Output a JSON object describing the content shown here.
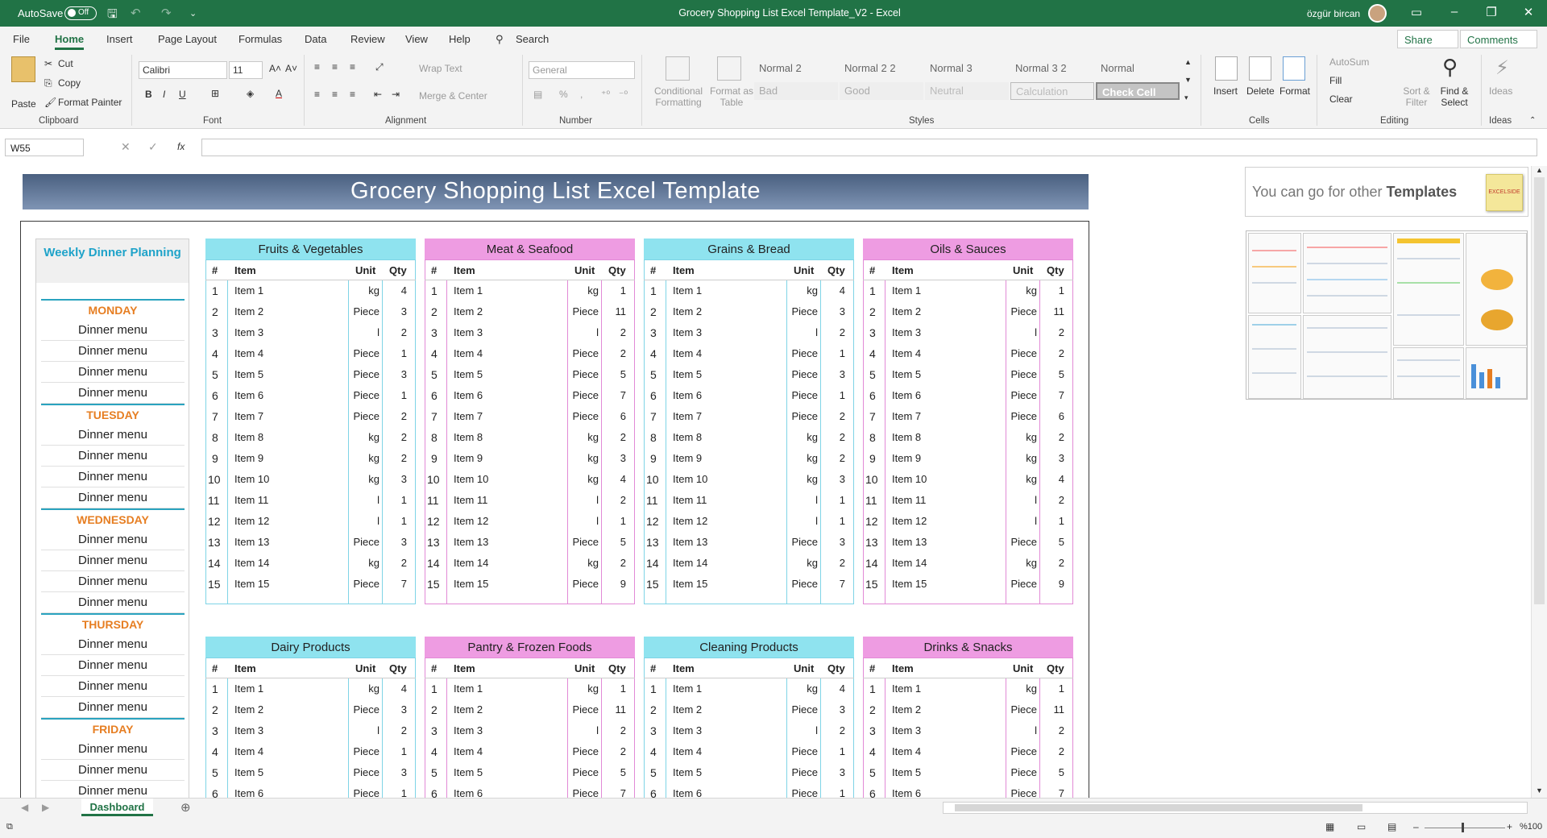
{
  "titlebar": {
    "autosave_label": "AutoSave",
    "autosave_state": "Off",
    "doc_title": "Grocery Shopping List Excel Template_V2  -  Excel",
    "user": "özgür bircan"
  },
  "tabs": [
    "File",
    "Home",
    "Insert",
    "Page Layout",
    "Formulas",
    "Data",
    "Review",
    "View",
    "Help"
  ],
  "search_label": "Search",
  "share_label": "Share",
  "comments_label": "Comments",
  "ribbon": {
    "clipboard": {
      "paste": "Paste",
      "cut": "Cut",
      "copy": "Copy",
      "format_painter": "Format Painter",
      "label": "Clipboard"
    },
    "font": {
      "name": "Calibri",
      "size": "11",
      "label": "Font"
    },
    "alignment": {
      "wrap": "Wrap Text",
      "merge": "Merge & Center",
      "label": "Alignment"
    },
    "number": {
      "format": "General",
      "label": "Number"
    },
    "styles": {
      "conditional": "Conditional Formatting",
      "format_table": "Format as Table",
      "cells": [
        "Normal 2",
        "Normal 2 2",
        "Normal 3",
        "Normal 3 2",
        "Normal",
        "Bad",
        "Good",
        "Neutral",
        "Calculation",
        "Check Cell"
      ],
      "label": "Styles"
    },
    "cells": {
      "insert": "Insert",
      "delete": "Delete",
      "format": "Format",
      "label": "Cells"
    },
    "editing": {
      "autosum": "AutoSum",
      "fill": "Fill",
      "clear": "Clear",
      "sort": "Sort & Filter",
      "find": "Find & Select",
      "label": "Editing"
    },
    "ideas": {
      "ideas": "Ideas",
      "label": "Ideas"
    }
  },
  "formula_bar": {
    "name_box": "W55",
    "fx": "fx",
    "content": ""
  },
  "sheet": {
    "banner": "Grocery Shopping List Excel Template",
    "templates_hint_pre": "You can go for other ",
    "templates_hint_bold": "Templates",
    "logo_text": "EXCELSIDE",
    "weekly": {
      "title": "Weekly Dinner Planning",
      "rows": [
        {
          "type": "day",
          "text": "MONDAY"
        },
        {
          "type": "menu",
          "text": "Dinner menu"
        },
        {
          "type": "menu",
          "text": "Dinner menu"
        },
        {
          "type": "menu",
          "text": "Dinner menu"
        },
        {
          "type": "menu",
          "text": "Dinner menu"
        },
        {
          "type": "day",
          "text": "TUESDAY"
        },
        {
          "type": "menu",
          "text": "Dinner menu"
        },
        {
          "type": "menu",
          "text": "Dinner menu"
        },
        {
          "type": "menu",
          "text": "Dinner menu"
        },
        {
          "type": "menu",
          "text": "Dinner menu"
        },
        {
          "type": "day",
          "text": "WEDNESDAY"
        },
        {
          "type": "menu",
          "text": "Dinner menu"
        },
        {
          "type": "menu",
          "text": "Dinner menu"
        },
        {
          "type": "menu",
          "text": "Dinner menu"
        },
        {
          "type": "menu",
          "text": "Dinner menu"
        },
        {
          "type": "day",
          "text": "THURSDAY"
        },
        {
          "type": "menu",
          "text": "Dinner menu"
        },
        {
          "type": "menu",
          "text": "Dinner menu"
        },
        {
          "type": "menu",
          "text": "Dinner menu"
        },
        {
          "type": "menu",
          "text": "Dinner menu"
        },
        {
          "type": "day",
          "text": "FRIDAY"
        },
        {
          "type": "menu",
          "text": "Dinner menu"
        },
        {
          "type": "menu",
          "text": "Dinner menu"
        },
        {
          "type": "menu",
          "text": "Dinner menu"
        }
      ]
    },
    "column_headers": {
      "num": "#",
      "item": "Item",
      "unit": "Unit",
      "qty": "Qty"
    },
    "lists": [
      {
        "title": "Fruits & Vegetables",
        "color": "cyan",
        "rows": [
          [
            "1",
            "Item 1",
            "kg",
            "4"
          ],
          [
            "2",
            "Item 2",
            "Piece",
            "3"
          ],
          [
            "3",
            "Item 3",
            "l",
            "2"
          ],
          [
            "4",
            "Item 4",
            "Piece",
            "1"
          ],
          [
            "5",
            "Item 5",
            "Piece",
            "3"
          ],
          [
            "6",
            "Item 6",
            "Piece",
            "1"
          ],
          [
            "7",
            "Item 7",
            "Piece",
            "2"
          ],
          [
            "8",
            "Item 8",
            "kg",
            "2"
          ],
          [
            "9",
            "Item 9",
            "kg",
            "2"
          ],
          [
            "10",
            "Item 10",
            "kg",
            "3"
          ],
          [
            "11",
            "Item 11",
            "l",
            "1"
          ],
          [
            "12",
            "Item 12",
            "l",
            "1"
          ],
          [
            "13",
            "Item 13",
            "Piece",
            "3"
          ],
          [
            "14",
            "Item 14",
            "kg",
            "2"
          ],
          [
            "15",
            "Item 15",
            "Piece",
            "7"
          ]
        ]
      },
      {
        "title": "Meat & Seafood",
        "color": "pink",
        "rows": [
          [
            "1",
            "Item 1",
            "kg",
            "1"
          ],
          [
            "2",
            "Item 2",
            "Piece",
            "11"
          ],
          [
            "3",
            "Item 3",
            "l",
            "2"
          ],
          [
            "4",
            "Item 4",
            "Piece",
            "2"
          ],
          [
            "5",
            "Item 5",
            "Piece",
            "5"
          ],
          [
            "6",
            "Item 6",
            "Piece",
            "7"
          ],
          [
            "7",
            "Item 7",
            "Piece",
            "6"
          ],
          [
            "8",
            "Item 8",
            "kg",
            "2"
          ],
          [
            "9",
            "Item 9",
            "kg",
            "3"
          ],
          [
            "10",
            "Item 10",
            "kg",
            "4"
          ],
          [
            "11",
            "Item 11",
            "l",
            "2"
          ],
          [
            "12",
            "Item 12",
            "l",
            "1"
          ],
          [
            "13",
            "Item 13",
            "Piece",
            "5"
          ],
          [
            "14",
            "Item 14",
            "kg",
            "2"
          ],
          [
            "15",
            "Item 15",
            "Piece",
            "9"
          ]
        ]
      },
      {
        "title": "Grains & Bread",
        "color": "cyan",
        "rows": [
          [
            "1",
            "Item 1",
            "kg",
            "4"
          ],
          [
            "2",
            "Item 2",
            "Piece",
            "3"
          ],
          [
            "3",
            "Item 3",
            "l",
            "2"
          ],
          [
            "4",
            "Item 4",
            "Piece",
            "1"
          ],
          [
            "5",
            "Item 5",
            "Piece",
            "3"
          ],
          [
            "6",
            "Item 6",
            "Piece",
            "1"
          ],
          [
            "7",
            "Item 7",
            "Piece",
            "2"
          ],
          [
            "8",
            "Item 8",
            "kg",
            "2"
          ],
          [
            "9",
            "Item 9",
            "kg",
            "2"
          ],
          [
            "10",
            "Item 10",
            "kg",
            "3"
          ],
          [
            "11",
            "Item 11",
            "l",
            "1"
          ],
          [
            "12",
            "Item 12",
            "l",
            "1"
          ],
          [
            "13",
            "Item 13",
            "Piece",
            "3"
          ],
          [
            "14",
            "Item 14",
            "kg",
            "2"
          ],
          [
            "15",
            "Item 15",
            "Piece",
            "7"
          ]
        ]
      },
      {
        "title": "Oils & Sauces",
        "color": "pink",
        "rows": [
          [
            "1",
            "Item 1",
            "kg",
            "1"
          ],
          [
            "2",
            "Item 2",
            "Piece",
            "11"
          ],
          [
            "3",
            "Item 3",
            "l",
            "2"
          ],
          [
            "4",
            "Item 4",
            "Piece",
            "2"
          ],
          [
            "5",
            "Item 5",
            "Piece",
            "5"
          ],
          [
            "6",
            "Item 6",
            "Piece",
            "7"
          ],
          [
            "7",
            "Item 7",
            "Piece",
            "6"
          ],
          [
            "8",
            "Item 8",
            "kg",
            "2"
          ],
          [
            "9",
            "Item 9",
            "kg",
            "3"
          ],
          [
            "10",
            "Item 10",
            "kg",
            "4"
          ],
          [
            "11",
            "Item 11",
            "l",
            "2"
          ],
          [
            "12",
            "Item 12",
            "l",
            "1"
          ],
          [
            "13",
            "Item 13",
            "Piece",
            "5"
          ],
          [
            "14",
            "Item 14",
            "kg",
            "2"
          ],
          [
            "15",
            "Item 15",
            "Piece",
            "9"
          ]
        ]
      },
      {
        "title": "Dairy Products",
        "color": "cyan",
        "rows": [
          [
            "1",
            "Item 1",
            "kg",
            "4"
          ],
          [
            "2",
            "Item 2",
            "Piece",
            "3"
          ],
          [
            "3",
            "Item 3",
            "l",
            "2"
          ],
          [
            "4",
            "Item 4",
            "Piece",
            "1"
          ],
          [
            "5",
            "Item 5",
            "Piece",
            "3"
          ],
          [
            "6",
            "Item 6",
            "Piece",
            "1"
          ]
        ]
      },
      {
        "title": "Pantry & Frozen Foods",
        "color": "pink",
        "rows": [
          [
            "1",
            "Item 1",
            "kg",
            "1"
          ],
          [
            "2",
            "Item 2",
            "Piece",
            "11"
          ],
          [
            "3",
            "Item 3",
            "l",
            "2"
          ],
          [
            "4",
            "Item 4",
            "Piece",
            "2"
          ],
          [
            "5",
            "Item 5",
            "Piece",
            "5"
          ],
          [
            "6",
            "Item 6",
            "Piece",
            "7"
          ]
        ]
      },
      {
        "title": "Cleaning Products",
        "color": "cyan",
        "rows": [
          [
            "1",
            "Item 1",
            "kg",
            "4"
          ],
          [
            "2",
            "Item 2",
            "Piece",
            "3"
          ],
          [
            "3",
            "Item 3",
            "l",
            "2"
          ],
          [
            "4",
            "Item 4",
            "Piece",
            "1"
          ],
          [
            "5",
            "Item 5",
            "Piece",
            "3"
          ],
          [
            "6",
            "Item 6",
            "Piece",
            "1"
          ]
        ]
      },
      {
        "title": "Drinks & Snacks",
        "color": "pink",
        "rows": [
          [
            "1",
            "Item 1",
            "kg",
            "1"
          ],
          [
            "2",
            "Item 2",
            "Piece",
            "11"
          ],
          [
            "3",
            "Item 3",
            "l",
            "2"
          ],
          [
            "4",
            "Item 4",
            "Piece",
            "2"
          ],
          [
            "5",
            "Item 5",
            "Piece",
            "5"
          ],
          [
            "6",
            "Item 6",
            "Piece",
            "7"
          ]
        ]
      }
    ]
  },
  "sheet_tab": "Dashboard",
  "status": {
    "zoom": "%100"
  }
}
